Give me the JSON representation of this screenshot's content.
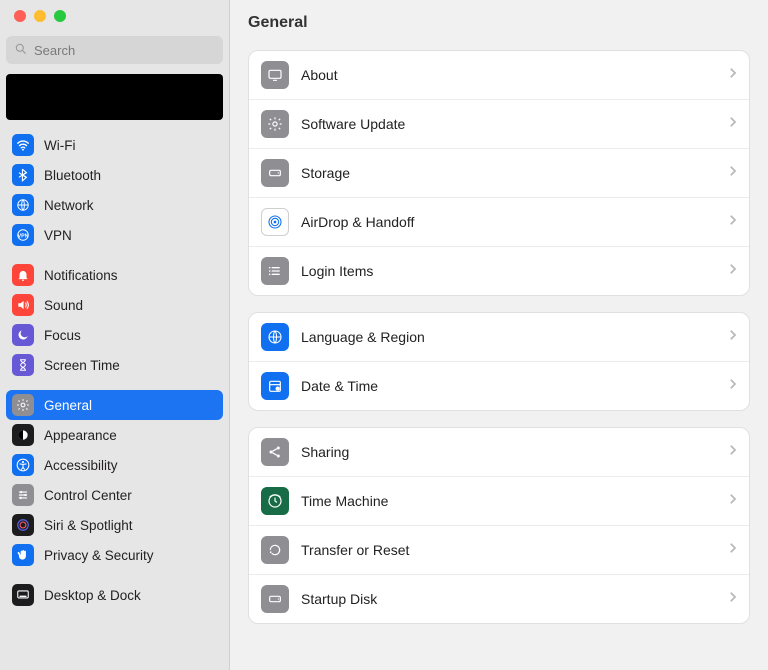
{
  "search": {
    "placeholder": "Search"
  },
  "page": {
    "title": "General"
  },
  "sidebar": {
    "groups": [
      [
        {
          "label": "Wi-Fi",
          "icon": "wifi",
          "bg": "#1070f0"
        },
        {
          "label": "Bluetooth",
          "icon": "bluetooth",
          "bg": "#1070f0"
        },
        {
          "label": "Network",
          "icon": "globe",
          "bg": "#1070f0"
        },
        {
          "label": "VPN",
          "icon": "vpn",
          "bg": "#1070f0"
        }
      ],
      [
        {
          "label": "Notifications",
          "icon": "bell",
          "bg": "#fe453a"
        },
        {
          "label": "Sound",
          "icon": "speaker",
          "bg": "#fe453a"
        },
        {
          "label": "Focus",
          "icon": "moon",
          "bg": "#6758d6"
        },
        {
          "label": "Screen Time",
          "icon": "hourglass",
          "bg": "#6758d6"
        }
      ],
      [
        {
          "label": "General",
          "icon": "gear",
          "bg": "#8e8e93",
          "selected": true
        },
        {
          "label": "Appearance",
          "icon": "appearance",
          "bg": "#1c1c1e"
        },
        {
          "label": "Accessibility",
          "icon": "accessibility",
          "bg": "#1070f0"
        },
        {
          "label": "Control Center",
          "icon": "sliders",
          "bg": "#8e8e93"
        },
        {
          "label": "Siri & Spotlight",
          "icon": "siri",
          "bg": "#1c1c1e"
        },
        {
          "label": "Privacy & Security",
          "icon": "hand",
          "bg": "#1070f0"
        }
      ],
      [
        {
          "label": "Desktop & Dock",
          "icon": "dock",
          "bg": "#1c1c1e"
        }
      ]
    ]
  },
  "main": {
    "groups": [
      [
        {
          "label": "About",
          "icon": "display",
          "bg": "#8e8e93"
        },
        {
          "label": "Software Update",
          "icon": "gear",
          "bg": "#8e8e93"
        },
        {
          "label": "Storage",
          "icon": "drive",
          "bg": "#8e8e93"
        },
        {
          "label": "AirDrop & Handoff",
          "icon": "airdrop",
          "bg": "#ffffff",
          "ring": true
        },
        {
          "label": "Login Items",
          "icon": "list",
          "bg": "#8e8e93"
        }
      ],
      [
        {
          "label": "Language & Region",
          "icon": "globe",
          "bg": "#1070f0"
        },
        {
          "label": "Date & Time",
          "icon": "calendar",
          "bg": "#1070f0"
        }
      ],
      [
        {
          "label": "Sharing",
          "icon": "share",
          "bg": "#8e8e93"
        },
        {
          "label": "Time Machine",
          "icon": "clock",
          "bg": "#176b46"
        },
        {
          "label": "Transfer or Reset",
          "icon": "reset",
          "bg": "#8e8e93"
        },
        {
          "label": "Startup Disk",
          "icon": "drive",
          "bg": "#8e8e93"
        }
      ]
    ]
  }
}
